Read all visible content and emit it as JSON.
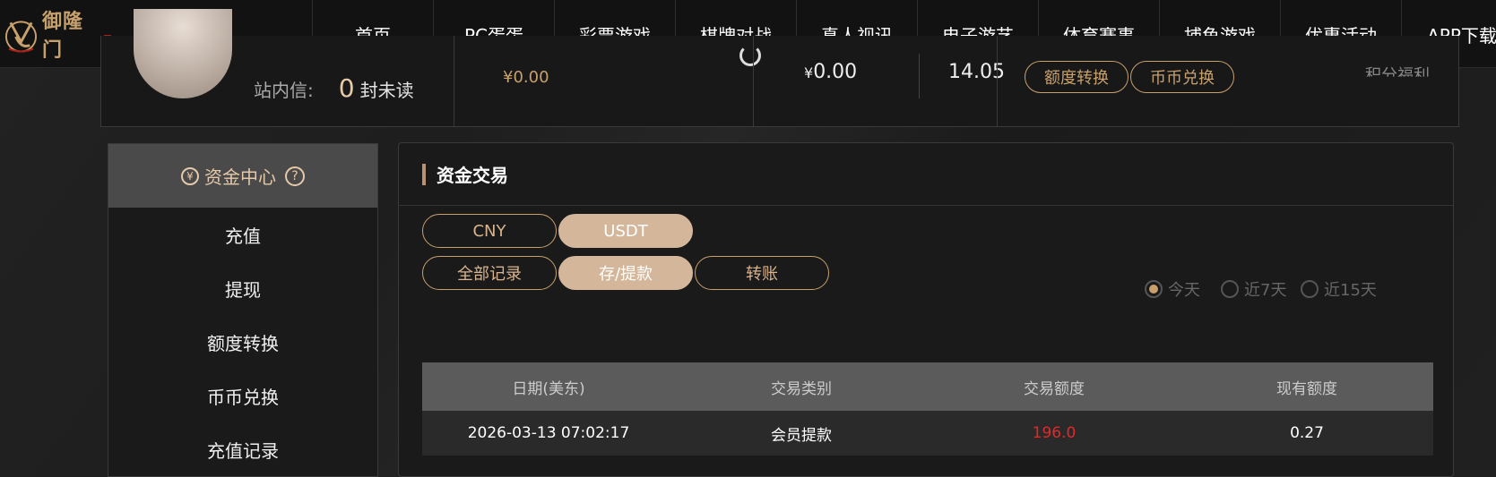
{
  "brand": {
    "name": "御隆门"
  },
  "nav": [
    "首页",
    "PC蛋蛋",
    "彩票游戏",
    "棋牌对战",
    "真人视讯",
    "电子游艺",
    "体育赛事",
    "捕鱼游戏",
    "优惠活动",
    "APP下载"
  ],
  "account": {
    "inbox_label": "站内信:",
    "inbox_count": "0",
    "inbox_unit": "封未读",
    "balance_1": "¥0.00",
    "balance_2_symbol": "¥",
    "balance_2": "0.00",
    "balance_3": "14.05",
    "quota_transfer": "额度转换",
    "coin_exchange": "币币兑换",
    "points": "积分福利"
  },
  "sidebar": {
    "title": "资金中心",
    "items": [
      "充值",
      "提现",
      "额度转换",
      "币币兑换",
      "充值记录"
    ]
  },
  "main": {
    "title": "资金交易",
    "currency_tabs": [
      "CNY",
      "USDT"
    ],
    "active_currency": "USDT",
    "record_tabs": [
      "全部记录",
      "存/提款",
      "转账"
    ],
    "active_record": "存/提款",
    "ranges": [
      "今天",
      "近7天",
      "近15天"
    ],
    "active_range": "今天",
    "table": {
      "headers": [
        "日期(美东)",
        "交易类别",
        "交易额度",
        "现有额度"
      ],
      "rows": [
        [
          "2026-03-13 07:02:17",
          "会员提款",
          "196.0",
          "0.27"
        ]
      ]
    }
  },
  "colors": {
    "accent": "#c7a06c",
    "active_tab": "#d4b79a",
    "amount_red": "#e02a2a"
  }
}
